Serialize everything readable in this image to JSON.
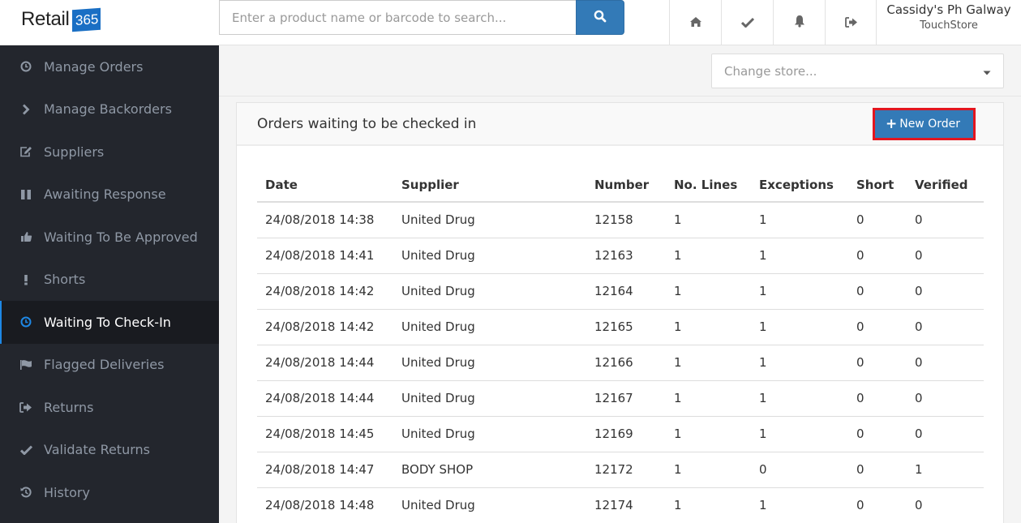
{
  "app": {
    "logo_text": "Retail",
    "logo_badge": "365"
  },
  "search": {
    "placeholder": "Enter a product name or barcode to search...",
    "value": "",
    "button_icon": "search-icon"
  },
  "top_icons": [
    "home-icon",
    "check-icon",
    "bell-icon",
    "sign-out-icon"
  ],
  "user": {
    "name": "Cassidy's Ph Galway",
    "store": "TouchStore"
  },
  "sidebar": {
    "items": [
      {
        "label": "Manage Orders",
        "icon": "clock-icon",
        "active": false
      },
      {
        "label": "Manage Backorders",
        "icon": "chevron-right-icon",
        "active": false
      },
      {
        "label": "Suppliers",
        "icon": "edit-icon",
        "active": false
      },
      {
        "label": "Awaiting Response",
        "icon": "pause-icon",
        "active": false
      },
      {
        "label": "Waiting To Be Approved",
        "icon": "thumbs-up-icon",
        "active": false
      },
      {
        "label": "Shorts",
        "icon": "exclamation-icon",
        "active": false
      },
      {
        "label": "Waiting To Check-In",
        "icon": "clock-icon",
        "active": true
      },
      {
        "label": "Flagged Deliveries",
        "icon": "flag-icon",
        "active": false
      },
      {
        "label": "Returns",
        "icon": "sign-out-icon",
        "active": false
      },
      {
        "label": "Validate Returns",
        "icon": "check-icon",
        "active": false
      },
      {
        "label": "History",
        "icon": "history-icon",
        "active": false
      }
    ]
  },
  "store_select": {
    "placeholder": "Change store..."
  },
  "panel": {
    "title": "Orders waiting to be checked in",
    "new_order_label": "New Order",
    "new_order_icon": "plus-icon"
  },
  "table": {
    "columns": [
      "Date",
      "Supplier",
      "Number",
      "No. Lines",
      "Exceptions",
      "Short",
      "Verified"
    ],
    "rows": [
      [
        "24/08/2018 14:38",
        "United Drug",
        "12158",
        "1",
        "1",
        "0",
        "0"
      ],
      [
        "24/08/2018 14:41",
        "United Drug",
        "12163",
        "1",
        "1",
        "0",
        "0"
      ],
      [
        "24/08/2018 14:42",
        "United Drug",
        "12164",
        "1",
        "1",
        "0",
        "0"
      ],
      [
        "24/08/2018 14:42",
        "United Drug",
        "12165",
        "1",
        "1",
        "0",
        "0"
      ],
      [
        "24/08/2018 14:44",
        "United Drug",
        "12166",
        "1",
        "1",
        "0",
        "0"
      ],
      [
        "24/08/2018 14:44",
        "United Drug",
        "12167",
        "1",
        "1",
        "0",
        "0"
      ],
      [
        "24/08/2018 14:45",
        "United Drug",
        "12169",
        "1",
        "1",
        "0",
        "0"
      ],
      [
        "24/08/2018 14:47",
        "BODY SHOP",
        "12172",
        "1",
        "0",
        "0",
        "1"
      ],
      [
        "24/08/2018 14:48",
        "United Drug",
        "12174",
        "1",
        "1",
        "0",
        "0"
      ]
    ]
  },
  "colors": {
    "primary": "#337ab7",
    "sidebar_bg": "#23262d",
    "sidebar_active_bg": "#191b20",
    "sidebar_active_accent": "#1e88e5",
    "highlight_box": "#e3161f"
  }
}
